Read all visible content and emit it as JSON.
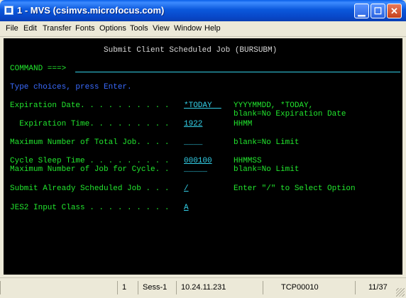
{
  "window": {
    "title": "1 - MVS (csimvs.microfocus.com)"
  },
  "menu": [
    "File",
    "Edit",
    "Transfer",
    "Fonts",
    "Options",
    "Tools",
    "View",
    "Window",
    "Help"
  ],
  "screen": {
    "heading": "Submit Client Scheduled Job (BURSUBM)",
    "command_label": "COMMAND ===>",
    "command_value": "",
    "instruction": "Type choices, press Enter.",
    "fields": [
      {
        "label": "Expiration Date. . . . . . . . . .",
        "value": "*TODAY  ",
        "hint": "YYYYMMDD, *TODAY,",
        "hint2": "blank=No Expiration Date"
      },
      {
        "label": "  Expiration Time. . . . . . . . .",
        "value": "1922",
        "hint": "HHMM"
      },
      {
        "label": "Maximum Number of Total Job. . . .",
        "value": "____",
        "hint": "blank=No Limit"
      },
      {
        "label": "Cycle Sleep Time . . . . . . . . .",
        "value": "000100",
        "hint": "HHMMSS"
      },
      {
        "label": "Maximum Number of Job for Cycle. .",
        "value": "_____",
        "hint": "blank=No Limit"
      },
      {
        "label": "Submit Already Scheduled Job . . .",
        "value": "/",
        "hint": "Enter \"/\" to Select Option"
      },
      {
        "label": "JES2 Input Class . . . . . . . . .",
        "value": "A"
      }
    ]
  },
  "status": {
    "session_number": "1",
    "session_name": "Sess-1",
    "ip": "10.24.11.231",
    "terminal_id": "TCP00010",
    "cursor": "11/37"
  },
  "colors": {
    "label": "#22e62e",
    "heading": "#d8d8d8",
    "instruction": "#3a6bff",
    "input": "#33d0e8"
  }
}
